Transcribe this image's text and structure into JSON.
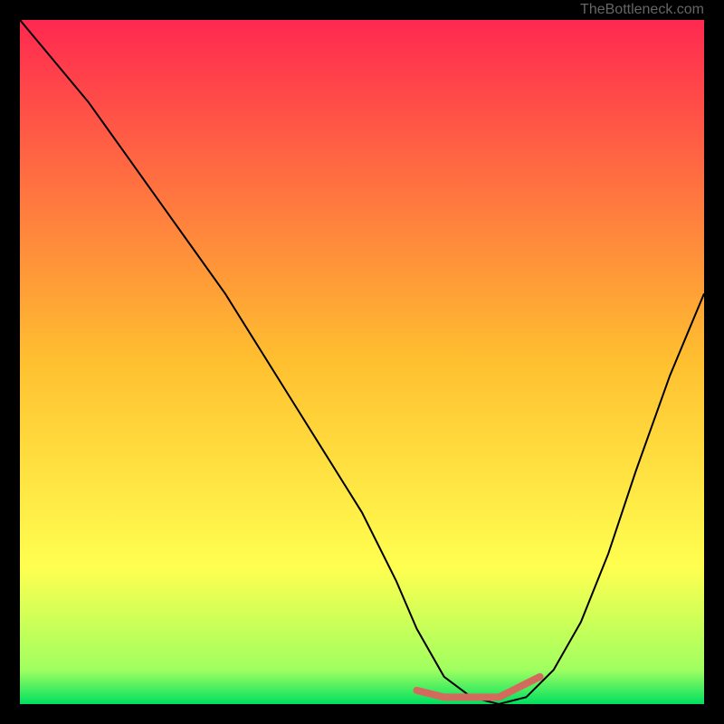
{
  "watermark": "TheBottleneck.com",
  "chart_data": {
    "type": "line",
    "title": "",
    "xlabel": "",
    "ylabel": "",
    "xlim": [
      0,
      100
    ],
    "ylim": [
      0,
      100
    ],
    "grid": false,
    "background_gradient": {
      "stops": [
        {
          "offset": 0,
          "color": "#ff2850"
        },
        {
          "offset": 50,
          "color": "#ffc030"
        },
        {
          "offset": 80,
          "color": "#ffff50"
        },
        {
          "offset": 95,
          "color": "#a0ff60"
        },
        {
          "offset": 100,
          "color": "#00e060"
        }
      ]
    },
    "series": [
      {
        "name": "curve",
        "x": [
          0,
          5,
          10,
          15,
          20,
          25,
          30,
          35,
          40,
          45,
          50,
          55,
          58,
          62,
          66,
          70,
          74,
          78,
          82,
          86,
          90,
          95,
          100
        ],
        "y": [
          100,
          94,
          88,
          81,
          74,
          67,
          60,
          52,
          44,
          36,
          28,
          18,
          11,
          4,
          1,
          0,
          1,
          5,
          12,
          22,
          34,
          48,
          60
        ]
      },
      {
        "name": "highlight",
        "x": [
          58,
          62,
          66,
          70,
          72,
          74,
          76
        ],
        "y": [
          2,
          1,
          1,
          1,
          2,
          3,
          4
        ]
      }
    ],
    "highlight_style": {
      "color": "#d46a5e",
      "width": 8,
      "cap": "round"
    },
    "curve_style": {
      "color": "#000000",
      "width": 2
    }
  }
}
